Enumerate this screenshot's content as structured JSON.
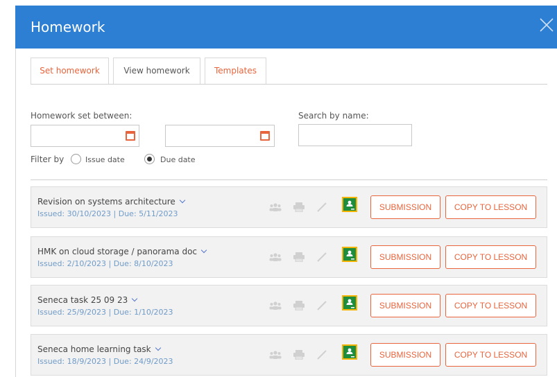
{
  "dialog": {
    "title": "Homework"
  },
  "tabs": [
    {
      "label": "Set homework"
    },
    {
      "label": "View homework"
    },
    {
      "label": "Templates"
    }
  ],
  "filters": {
    "set_between_label": "Homework set between:",
    "search_label": "Search by name:",
    "from_value": "",
    "to_value": "",
    "search_value": "",
    "filter_by_label": "Filter by",
    "options": [
      {
        "label": "Issue date",
        "checked": false
      },
      {
        "label": "Due date",
        "checked": true
      }
    ]
  },
  "homework": [
    {
      "title": "Revision on systems architecture",
      "dates": "Issued: 30/10/2023 | Due: 5/11/2023"
    },
    {
      "title": "HMK on cloud storage / panorama doc",
      "dates": "Issued: 2/10/2023 | Due: 8/10/2023"
    },
    {
      "title": "Seneca task 25 09 23",
      "dates": "Issued: 25/9/2023 | Due: 1/10/2023"
    },
    {
      "title": "Seneca home learning task",
      "dates": "Issued: 18/9/2023 | Due: 24/9/2023"
    }
  ],
  "actions": {
    "submission_label": "SUBMISSION",
    "copy_label": "COPY TO LESSON"
  },
  "icons": [
    "close-icon",
    "calendar-icon",
    "students-icon",
    "print-icon",
    "edit-icon",
    "google-classroom-icon",
    "chevron-down-icon"
  ],
  "colors": {
    "header": "#2d7fd3",
    "accent": "#e8643c",
    "row_bg": "#f2f2f2",
    "dates_text": "#6f9bc8",
    "classroom": "#1e8e3e"
  }
}
